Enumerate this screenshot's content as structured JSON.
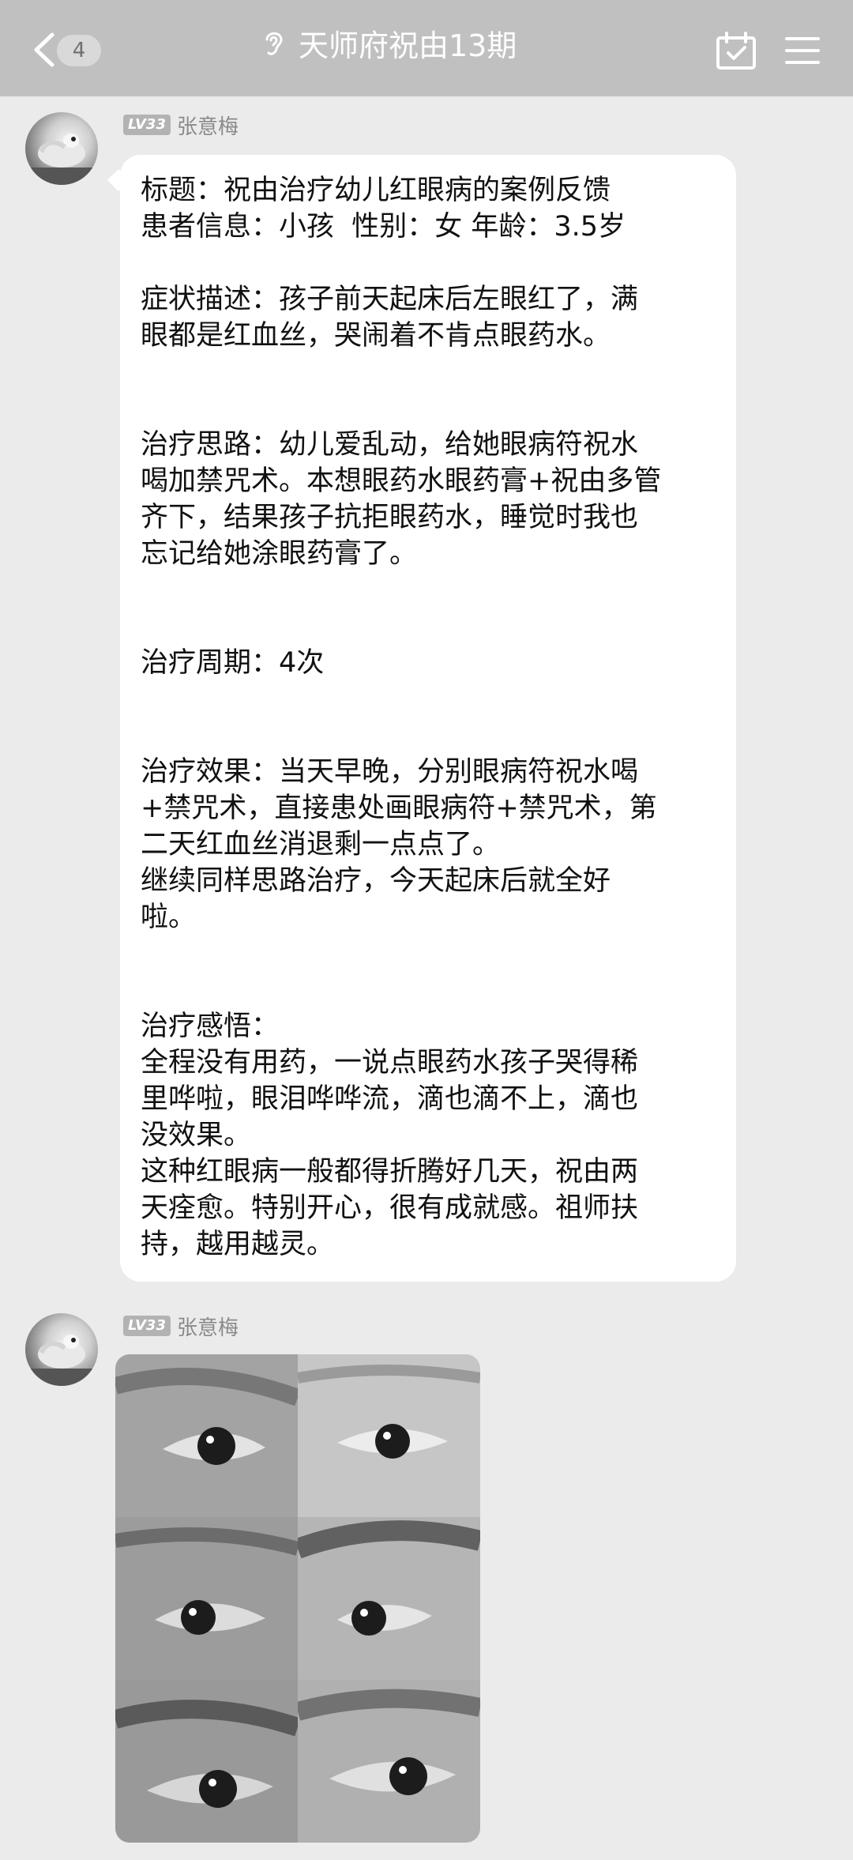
{
  "header": {
    "unread_count": "4",
    "title": "天师府祝由13期",
    "back_icon": "chevron-left-icon",
    "ear_icon": "ear-icon",
    "calendar_icon": "calendar-check-icon",
    "menu_icon": "hamburger-menu-icon"
  },
  "messages": [
    {
      "level": "LV33",
      "sender": "张意梅",
      "paragraphs": {
        "p1": "标题：祝由治疗幼儿红眼病的案例反馈\n患者信息：小孩  性别：女 年龄：3.5岁",
        "p2": "症状描述：孩子前天起床后左眼红了，满\n眼都是红血丝，哭闹着不肯点眼药水。",
        "p3": "治疗思路：幼儿爱乱动，给她眼病符祝水\n喝加禁咒术。本想眼药水眼药膏+祝由多管\n齐下，结果孩子抗拒眼药水，睡觉时我也\n忘记给她涂眼药膏了。",
        "p4": "治疗周期：4次",
        "p5": "治疗效果：当天早晚，分别眼病符祝水喝\n+禁咒术，直接患处画眼病符+禁咒术，第\n二天红血丝消退剩一点点了。\n继续同样思路治疗，今天起床后就全好\n啦。",
        "p6": "治疗感悟：\n全程没有用药，一说点眼药水孩子哭得稀\n里哗啦，眼泪哗哗流，滴也滴不上，滴也\n没效果。\n这种红眼病一般都得折腾好几天，祝由两\n天痊愈。特别开心，很有成就感。祖师扶\n持，越用越灵。"
      }
    },
    {
      "level": "LV33",
      "sender": "张意梅",
      "photos": [
        "eye-photo-1",
        "eye-photo-2",
        "eye-photo-3",
        "eye-photo-4",
        "eye-photo-5",
        "eye-photo-6"
      ]
    }
  ],
  "colors": {
    "header_bg": "#c0c0c0",
    "page_bg": "#ebebeb",
    "bubble_bg": "#ffffff"
  }
}
